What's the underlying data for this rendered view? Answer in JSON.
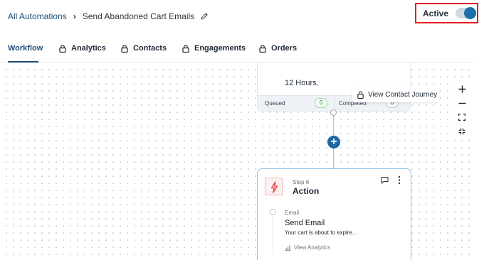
{
  "breadcrumb": {
    "parent": "All Automations",
    "current": "Send Abandoned Cart Emails"
  },
  "status": {
    "label": "Active",
    "enabled": true,
    "toggle_color": "#1c6fa9"
  },
  "tabs": [
    {
      "label": "Workflow",
      "active": true,
      "locked": false
    },
    {
      "label": "Analytics",
      "active": false,
      "locked": true
    },
    {
      "label": "Contacts",
      "active": false,
      "locked": true
    },
    {
      "label": "Engagements",
      "active": false,
      "locked": true
    },
    {
      "label": "Orders",
      "active": false,
      "locked": true
    }
  ],
  "top_card": {
    "text": "12 Hours.",
    "queued_label": "Queued",
    "queued_count": "0",
    "completed_label": "Completed",
    "completed_count": "0"
  },
  "tooltip": {
    "label": "View Contact Journey",
    "icon": "lock-icon"
  },
  "action_card": {
    "step": "Step 6",
    "title": "Action",
    "icon": "lightning-icon",
    "email_label": "Email",
    "email_title": "Send Email",
    "email_desc": "Your cart is about to expire...",
    "view_analytics": "View Analytics"
  },
  "zoom": {
    "buttons": [
      "zoom-in-icon",
      "zoom-out-icon",
      "fit-screen-icon",
      "fullscreen-icon"
    ]
  },
  "colors": {
    "brand": "#1a4d7a",
    "accent": "#1e66a6",
    "highlight_border": "#e02020",
    "action_icon": "#e03a3a"
  }
}
